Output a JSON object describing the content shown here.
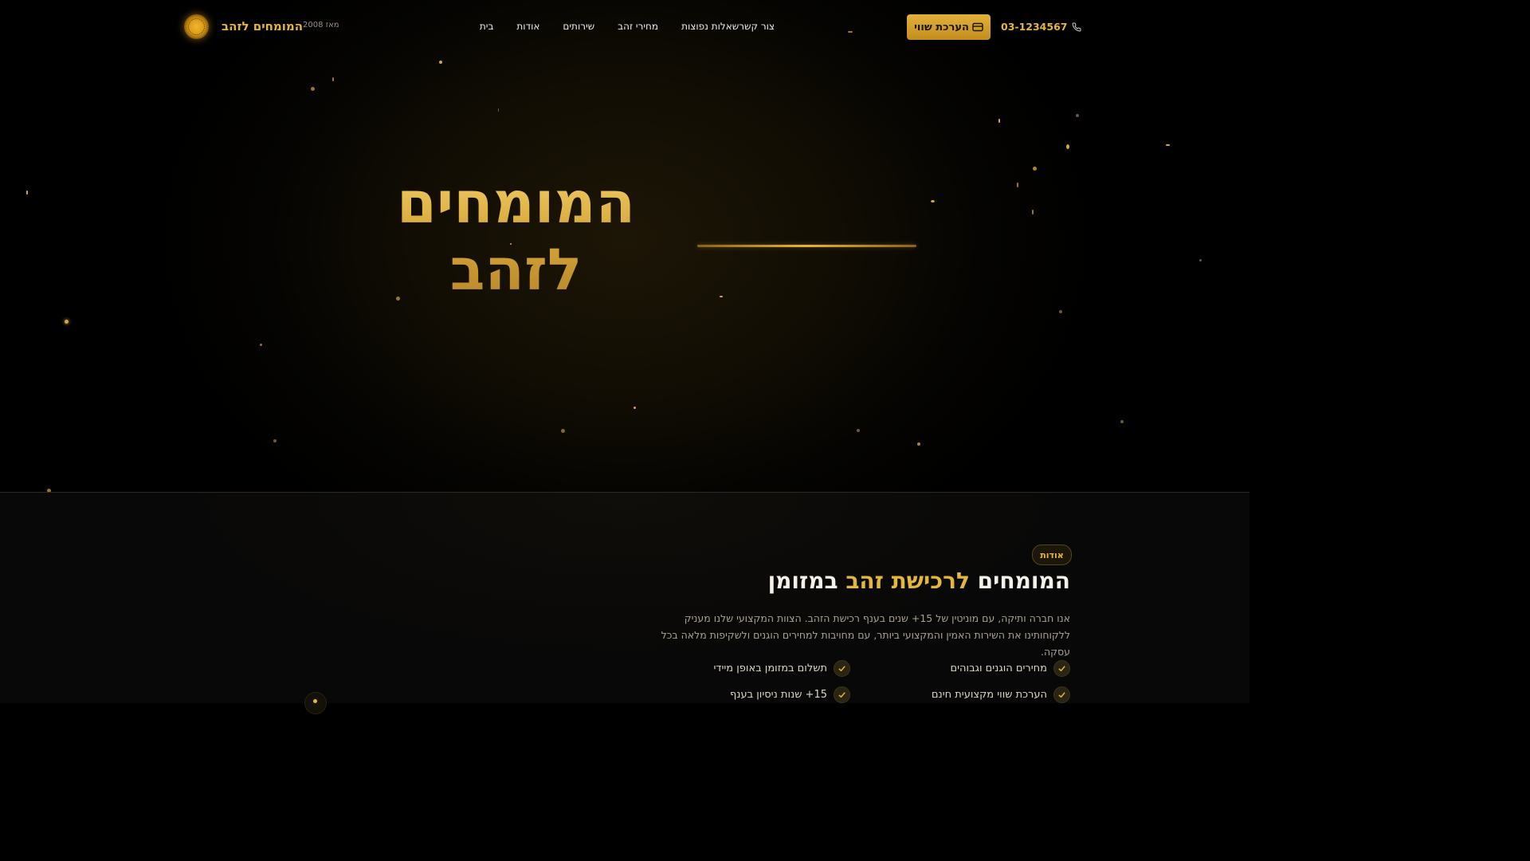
{
  "header": {
    "brand": "המומחים לזהב",
    "since": "מאז 2008",
    "nav": [
      "בית",
      "אודות",
      "שירותים",
      "מחירי זהב",
      "שאלות נפוצות",
      "צור קשר"
    ],
    "cta_label": "הערכת שווי",
    "phone": "03-1234567"
  },
  "hero": {
    "title_line1": "המומחים",
    "title_line2": "לזהב"
  },
  "about": {
    "badge": "אודות",
    "title_part1": "המומחים",
    "title_highlight": "לרכישת זהב",
    "title_part2": "במזומן",
    "paragraph": "אנו חברה ותיקה, עם מוניטין של 15+ שנים בענף רכישת הזהב. הצוות המקצועי שלנו מעניק ללקוחותינו את השירות האמין והמקצועי ביותר, עם מחויבות למחירים הוגנים ולשקיפות מלאה בכל עסקה.",
    "features": [
      "מחירים הוגנים וגבוהים",
      "תשלום במזומן באופן מיידי",
      "הערכת שווי מקצועית חינם",
      "15+ שנות ניסיון בענף"
    ]
  },
  "colors": {
    "accent": "#e3b63c",
    "background": "#000000"
  },
  "icons": [
    "logo-coin-icon",
    "phone-icon",
    "card-icon",
    "check-icon"
  ]
}
